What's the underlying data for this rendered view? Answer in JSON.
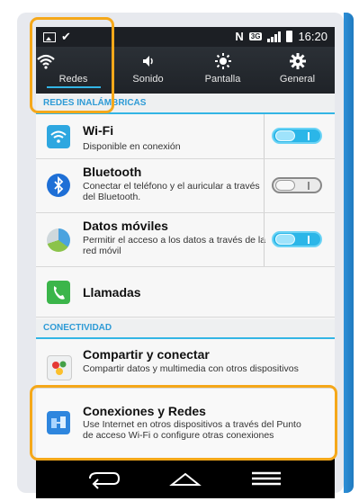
{
  "status_bar": {
    "time": "16:20",
    "network_badge": "3G"
  },
  "quick_settings": [
    {
      "label": "Redes",
      "icon": "wifi-icon",
      "active": true
    },
    {
      "label": "Sonido",
      "icon": "speaker-icon",
      "active": false
    },
    {
      "label": "Pantalla",
      "icon": "brightness-icon",
      "active": false
    },
    {
      "label": "General",
      "icon": "gear-icon",
      "active": false
    }
  ],
  "sections": {
    "wireless": "REDES INALÁMBRICAS",
    "connectivity": "CONECTIVIDAD"
  },
  "items": {
    "wifi": {
      "title": "Wi-Fi",
      "subtitle": "Disponible en conexión",
      "toggle": "on"
    },
    "bluetooth": {
      "title": "Bluetooth",
      "subtitle": "Conectar el teléfono y el auricular a través del Bluetooth.",
      "toggle": "off"
    },
    "mobile_data": {
      "title": "Datos móviles",
      "subtitle": "Permitir el acceso a los datos a través de la red móvil",
      "toggle": "on"
    },
    "calls": {
      "title": "Llamadas"
    },
    "share": {
      "title": "Compartir y conectar",
      "subtitle": "Compartir datos y multimedia con otros dispositivos"
    },
    "tethering": {
      "title": "Conexiones y Redes",
      "subtitle": "Use Internet en otros dispositivos a través del Punto de acceso Wi-Fi o configure otras conexiones"
    }
  },
  "colors": {
    "accent": "#33b5e5",
    "highlight": "#f5a81a",
    "section_text": "#2e9bd6"
  }
}
